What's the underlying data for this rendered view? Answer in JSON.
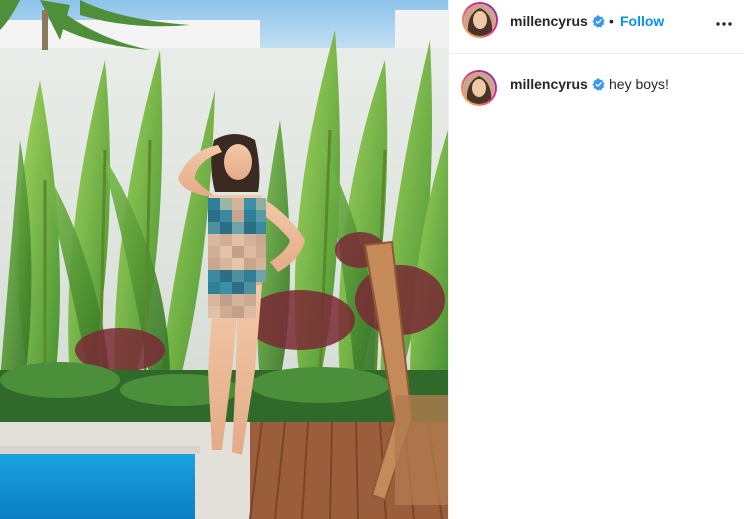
{
  "post": {
    "header": {
      "username": "millencyrus",
      "separator": "•",
      "follow_label": "Follow"
    },
    "caption": {
      "username": "millencyrus",
      "text": "hey boys!"
    }
  },
  "icons": {
    "verified": "verified-badge-icon",
    "more": "more-options-icon"
  },
  "colors": {
    "accent": "#0095f6",
    "verified": "#3897f0",
    "text": "#262626",
    "divider": "#efefef"
  }
}
